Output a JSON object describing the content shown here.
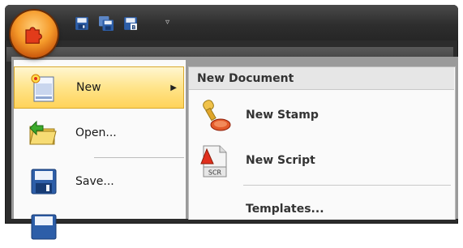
{
  "quick_access": {
    "items": [
      "save-icon",
      "save-all-icon",
      "save-b-icon"
    ],
    "overflow_arrow": "▿"
  },
  "app_menu": {
    "items": [
      {
        "label": "New",
        "highlighted": true,
        "has_submenu": true,
        "icon": "new-document-icon"
      },
      {
        "label": "Open...",
        "icon": "open-folder-icon"
      },
      {
        "label": "Save...",
        "icon": "save-icon"
      }
    ],
    "submenu_arrow": "▶"
  },
  "submenu": {
    "title": "New Document",
    "items": [
      {
        "label": "New Stamp",
        "icon": "stamp-icon"
      },
      {
        "label": "New Script",
        "icon": "script-file-icon",
        "icon_text": "SCR"
      },
      {
        "label": "Templates..."
      }
    ]
  },
  "colors": {
    "orb": "#f59a2a",
    "highlight": "#ffe48a",
    "highlight_border": "#d9a82b"
  }
}
